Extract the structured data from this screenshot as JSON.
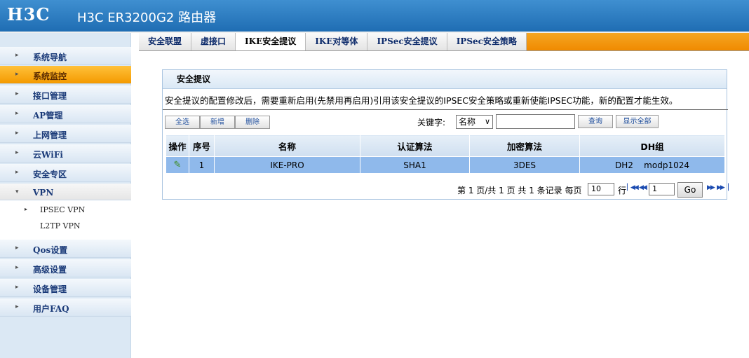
{
  "header": {
    "logo": "H3C",
    "product": "H3C ER3200G2 路由器"
  },
  "sidebar": {
    "items": [
      {
        "label": "系统导航"
      },
      {
        "label": "系统监控"
      },
      {
        "label": "接口管理"
      },
      {
        "label": "AP管理"
      },
      {
        "label": "上网管理"
      },
      {
        "label": "云WiFi"
      },
      {
        "label": "安全专区"
      },
      {
        "label": "VPN"
      },
      {
        "label": "Qos设置"
      },
      {
        "label": "高级设置"
      },
      {
        "label": "设备管理"
      },
      {
        "label": "用户FAQ"
      }
    ],
    "vpn_sub": [
      {
        "label": "IPSEC VPN"
      },
      {
        "label": "L2TP VPN"
      }
    ]
  },
  "tabs": [
    {
      "label": "安全联盟"
    },
    {
      "label": "虚接口"
    },
    {
      "label": "IKE安全提议"
    },
    {
      "label": "IKE对等体"
    },
    {
      "label": "IPSec安全提议"
    },
    {
      "label": "IPSec安全策略"
    }
  ],
  "panel": {
    "title": "安全提议",
    "notice": "安全提议的配置修改后，需要重新启用(先禁用再启用)引用该安全提议的IPSEC安全策略或重新使能IPSEC功能，新的配置才能生效。",
    "buttons": {
      "select_all": "全选",
      "add": "新增",
      "delete": "删除",
      "query": "查询",
      "show_all": "显示全部"
    },
    "keyword_label": "关键字:",
    "keyword_select": "名称",
    "keyword_value": ""
  },
  "table": {
    "headers": [
      "操作",
      "序号",
      "名称",
      "认证算法",
      "加密算法",
      "DH组"
    ],
    "rows": [
      {
        "index": "1",
        "name": "IKE-PRO",
        "auth": "SHA1",
        "enc": "3DES",
        "dh": "DH2    modp1024"
      }
    ]
  },
  "pager": {
    "info": "第 1 页/共 1 页 共 1 条记录 每页",
    "per_page": "10",
    "rows_label": "行",
    "page": "1",
    "go": "Go"
  }
}
